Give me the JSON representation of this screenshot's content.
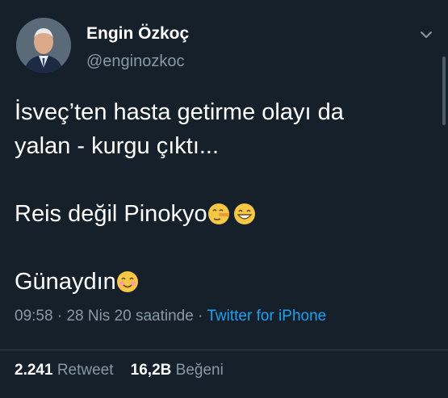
{
  "user": {
    "name": "Engin Özkoç",
    "handle": "@enginozkoc"
  },
  "tweet": {
    "lines": [
      "İsveç’ten hasta getirme olayı da",
      "yalan - kurgu çıktı...",
      "Reis değil Pinokyo",
      "Günaydın"
    ],
    "emojis": [
      "lying-face-emoji",
      "grinning-face-emoji",
      "smiling-face-blush-emoji"
    ]
  },
  "meta": {
    "time": "09:58",
    "sep1": " · ",
    "date": "28 Nis 20 saatinde",
    "sep2": " · ",
    "source": "Twitter for iPhone"
  },
  "stats": {
    "retweets_count": "2.241",
    "retweets_label": "Retweet",
    "likes_count": "16,2B",
    "likes_label": "Beğeni"
  },
  "colors": {
    "background": "#15202b",
    "secondary_text": "#8899a6",
    "link": "#1da1f2"
  }
}
